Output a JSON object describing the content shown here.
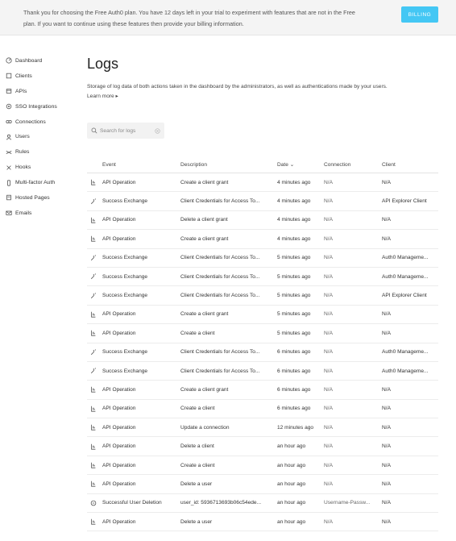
{
  "banner": {
    "text": "Thank you for choosing the Free Auth0 plan. You have 12 days left in your trial to experiment with features that are not in the Free plan. If you want to continue using these features then provide your billing information.",
    "billing_label": "BILLING",
    "billing_color": "#44c7f4"
  },
  "sidebar": {
    "items": [
      {
        "label": "Dashboard",
        "icon": "dashboard-icon"
      },
      {
        "label": "Clients",
        "icon": "clients-icon"
      },
      {
        "label": "APIs",
        "icon": "apis-icon"
      },
      {
        "label": "SSO Integrations",
        "icon": "sso-icon"
      },
      {
        "label": "Connections",
        "icon": "connections-icon"
      },
      {
        "label": "Users",
        "icon": "users-icon"
      },
      {
        "label": "Rules",
        "icon": "rules-icon"
      },
      {
        "label": "Hooks",
        "icon": "hooks-icon"
      },
      {
        "label": "Multi-factor Auth",
        "icon": "mfa-icon"
      },
      {
        "label": "Hosted Pages",
        "icon": "hosted-pages-icon"
      },
      {
        "label": "Emails",
        "icon": "emails-icon"
      }
    ]
  },
  "main": {
    "title": "Logs",
    "description": "Storage of log data of both actions taken in the dashboard by the administrators, as well as authentications made by your users.",
    "learn_more": "Learn more ▸",
    "search_placeholder": "Search for logs"
  },
  "table": {
    "headers": {
      "event": "Event",
      "description": "Description",
      "date": "Date ⌄",
      "connection": "Connection",
      "client": "Client"
    },
    "rows": [
      {
        "event": "API Operation",
        "icon": "api-operation-icon",
        "description": "Create a client grant",
        "date": "4 minutes ago",
        "connection": "N/A",
        "client": "N/A"
      },
      {
        "event": "Success Exchange",
        "icon": "exchange-icon",
        "description": "Client Credentials for Access To...",
        "date": "4 minutes ago",
        "connection": "N/A",
        "client": "API Explorer Client"
      },
      {
        "event": "API Operation",
        "icon": "api-operation-icon",
        "description": "Delete a client grant",
        "date": "4 minutes ago",
        "connection": "N/A",
        "client": "N/A"
      },
      {
        "event": "API Operation",
        "icon": "api-operation-icon",
        "description": "Create a client grant",
        "date": "4 minutes ago",
        "connection": "N/A",
        "client": "N/A"
      },
      {
        "event": "Success Exchange",
        "icon": "exchange-icon",
        "description": "Client Credentials for Access To...",
        "date": "5 minutes ago",
        "connection": "N/A",
        "client": "Auth0 Manageme..."
      },
      {
        "event": "Success Exchange",
        "icon": "exchange-icon",
        "description": "Client Credentials for Access To...",
        "date": "5 minutes ago",
        "connection": "N/A",
        "client": "Auth0 Manageme..."
      },
      {
        "event": "Success Exchange",
        "icon": "exchange-icon",
        "description": "Client Credentials for Access To...",
        "date": "5 minutes ago",
        "connection": "N/A",
        "client": "API Explorer Client"
      },
      {
        "event": "API Operation",
        "icon": "api-operation-icon",
        "description": "Create a client grant",
        "date": "5 minutes ago",
        "connection": "N/A",
        "client": "N/A"
      },
      {
        "event": "API Operation",
        "icon": "api-operation-icon",
        "description": "Create a client",
        "date": "5 minutes ago",
        "connection": "N/A",
        "client": "N/A"
      },
      {
        "event": "Success Exchange",
        "icon": "exchange-icon",
        "description": "Client Credentials for Access To...",
        "date": "6 minutes ago",
        "connection": "N/A",
        "client": "Auth0 Manageme..."
      },
      {
        "event": "Success Exchange",
        "icon": "exchange-icon",
        "description": "Client Credentials for Access To...",
        "date": "6 minutes ago",
        "connection": "N/A",
        "client": "Auth0 Manageme..."
      },
      {
        "event": "API Operation",
        "icon": "api-operation-icon",
        "description": "Create a client grant",
        "date": "6 minutes ago",
        "connection": "N/A",
        "client": "N/A"
      },
      {
        "event": "API Operation",
        "icon": "api-operation-icon",
        "description": "Create a client",
        "date": "6 minutes ago",
        "connection": "N/A",
        "client": "N/A"
      },
      {
        "event": "API Operation",
        "icon": "api-operation-icon",
        "description": "Update a connection",
        "date": "12 minutes ago",
        "connection": "N/A",
        "client": "N/A"
      },
      {
        "event": "API Operation",
        "icon": "api-operation-icon",
        "description": "Delete a client",
        "date": "an hour ago",
        "connection": "N/A",
        "client": "N/A"
      },
      {
        "event": "API Operation",
        "icon": "api-operation-icon",
        "description": "Create a client",
        "date": "an hour ago",
        "connection": "N/A",
        "client": "N/A"
      },
      {
        "event": "API Operation",
        "icon": "api-operation-icon",
        "description": "Delete a user",
        "date": "an hour ago",
        "connection": "N/A",
        "client": "N/A"
      },
      {
        "event": "Successful User Deletion",
        "icon": "user-deletion-icon",
        "description": "user_id: 5936713693b06c54ede...",
        "date": "an hour ago",
        "connection": "Username-Passw...",
        "client": "N/A"
      },
      {
        "event": "API Operation",
        "icon": "api-operation-icon",
        "description": "Delete a user",
        "date": "an hour ago",
        "connection": "N/A",
        "client": "N/A"
      }
    ]
  }
}
